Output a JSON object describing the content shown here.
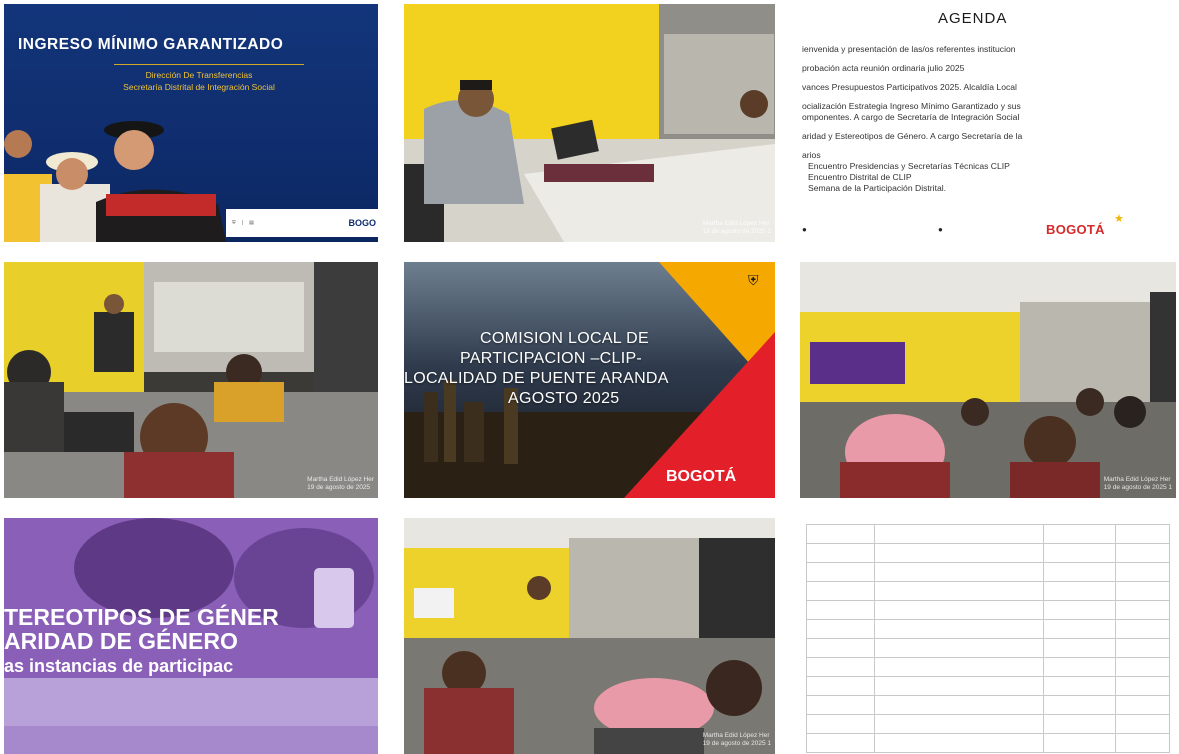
{
  "tile1": {
    "title": "INGRESO MÍNIMO GARANTIZADO",
    "subtitle_1": "Dirección De Transferencias",
    "subtitle_2": "Secretaría Distrital de Integración Social",
    "footer_brand": "BOGO",
    "colors": {
      "bg": "#13357a",
      "accent": "#f2c230"
    }
  },
  "tile2": {
    "watermark_1": "Martha Edid López Her",
    "watermark_2": "19 de agosto de 2025 1"
  },
  "tile3": {
    "title": "AGENDA",
    "items": [
      "ienvenida y presentación de las/os referentes institucion",
      "probación acta reunión ordinaria julio 2025",
      "vances Presupuestos Participativos 2025. Alcaldía Local",
      "ocialización Estrategia Ingreso Mínimo Garantizado y sus",
      "omponentes. A cargo de Secretaría de Integración Social",
      "aridad y Estereotipos de Género. A cargo Secretaría de la",
      "arios",
      "Encuentro Presidencias y Secretarías Técnicas CLIP",
      "Encuentro Distrital de CLIP",
      "Semana de la Participación Distrital."
    ],
    "brand": "BOGOTÁ"
  },
  "tile4": {
    "watermark_1": "Martha Edid López Her",
    "watermark_2": "19 de agosto de 2025"
  },
  "tile5": {
    "line1": "COMISION LOCAL DE",
    "line2": "PARTICIPACION –CLIP-",
    "line3": "LOCALIDAD DE PUENTE ARANDA",
    "line4": "AGOSTO 2025",
    "brand": "BOGOTÁ"
  },
  "tile6": {
    "watermark_1": "Martha Edid López Her",
    "watermark_2": "19 de agosto de 2025 1"
  },
  "tile7": {
    "line1": "TEREOTIPOS DE GÉNER",
    "line2": "ARIDAD DE GÉNERO",
    "line3": "as instancias de participac"
  },
  "tile8": {
    "watermark_1": "Martha Edid López Her",
    "watermark_2": "19 de agosto de 2025 1"
  }
}
